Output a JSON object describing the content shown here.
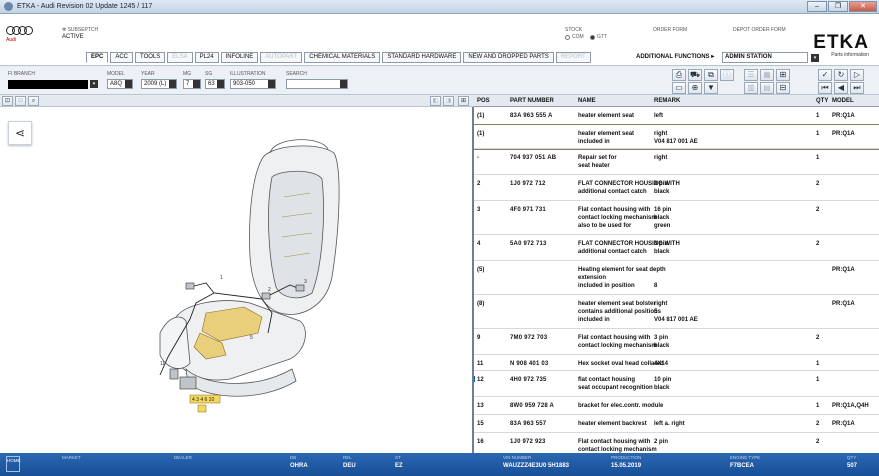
{
  "window": {
    "title": "ETKA - Audi Revision 02 Update 1245 / 117",
    "buttons": [
      "–",
      "❐",
      "✕"
    ]
  },
  "header": {
    "brand_word": "Audi",
    "sub_label": "✻ SUBSEPTCH",
    "sub_value": "ACTIVE",
    "radio_label": "STOCK",
    "radio_a": "COM",
    "radio_b": "GTT",
    "order_label": "ORDER FORM",
    "depot_label": "DEPOT ORDER FORM",
    "etka": "ETKA",
    "etka_sub": "Parts information"
  },
  "tabs": [
    {
      "label": "EPC",
      "state": "active"
    },
    {
      "label": "ACC",
      "state": "normal"
    },
    {
      "label": "TOOLS",
      "state": "normal"
    },
    {
      "label": "ELSA",
      "state": "disabled"
    },
    {
      "label": "PL24",
      "state": "normal"
    },
    {
      "label": "INFOLINE",
      "state": "normal"
    },
    {
      "label": "AUTOPART",
      "state": "disabled"
    },
    {
      "label": "CHEMICAL MATERIALS",
      "state": "normal"
    },
    {
      "label": "STANDARD HARDWARE",
      "state": "normal"
    },
    {
      "label": "NEW AND DROPPED PARTS",
      "state": "normal"
    },
    {
      "label": "REPORT",
      "state": "disabled"
    }
  ],
  "additional_functions": "ADDITIONAL FUNCTIONS ▸",
  "station": "ADMIN STATION",
  "selection": {
    "fi_label": "FI BRANCH",
    "model_label": "MODEL",
    "model": "A8Q",
    "year_label": "YEAR",
    "year": "2009 (L)",
    "mg_label": "MG",
    "mg": "7",
    "sg_label": "SG",
    "sg": "63",
    "illus_label": "ILLUSTRATION",
    "illus": "903-050",
    "search_label": "SEARCH"
  },
  "table": {
    "headers": {
      "pos": "POS",
      "part": "PART NUMBER",
      "name": "NAME",
      "remark": "REMARK",
      "qty": "QTY",
      "model": "MODEL"
    },
    "rows": [
      {
        "pos": "(1)",
        "part": "83A 963 555 A",
        "name": "heater element seat",
        "remark": "left",
        "qty": "1",
        "model": "PR:Q1A",
        "h": 18
      },
      {
        "pos": "(1)",
        "part": "",
        "name": "heater element seat\n      included in",
        "remark": "right\nV04 817 001 AE",
        "qty": "1",
        "model": "PR:Q1A",
        "h": 24,
        "sel": true
      },
      {
        "pos": "-",
        "part": "704 937 051 AB",
        "name": "Repair set for\nseat heater",
        "remark": "right",
        "qty": "1",
        "model": "",
        "h": 26
      },
      {
        "pos": "2",
        "part": "1J0 972 712",
        "name": "FLAT CONNECTOR HOUSING WITH\nadditional contact catch",
        "remark": "2 pin\nblack",
        "qty": "2",
        "model": "",
        "h": 26
      },
      {
        "pos": "3",
        "part": "4F0 971 731",
        "name": "Flat contact housing with\ncontact locking mechanism\n      also to be used for",
        "remark": "16 pin\nblack\ngreen",
        "qty": "2",
        "model": "",
        "h": 34
      },
      {
        "pos": "4",
        "part": "5A0 972 713",
        "name": "FLAT CONNECTOR HOUSING WITH\nadditional contact catch",
        "remark": "3 pin\nblack",
        "qty": "2",
        "model": "",
        "h": 26
      },
      {
        "pos": "(5)",
        "part": "",
        "name": "Heating element for seat depth\nextension\n      included in position",
        "remark": "\n\n8",
        "qty": "",
        "model": "PR:Q1A",
        "h": 34
      },
      {
        "pos": "(8)",
        "part": "",
        "name": "heater element seat bolster\ncontains additional positions\n      included in",
        "remark": "right\n5\nV04 817 001 AE",
        "qty": "",
        "model": "PR:Q1A",
        "h": 34
      },
      {
        "pos": "9",
        "part": "7M0 972 703",
        "name": "Flat contact housing with\ncontact locking mechanism",
        "remark": "3 pin\nblack",
        "qty": "2",
        "model": "",
        "h": 26
      },
      {
        "pos": "11",
        "part": "N 908 401 03",
        "name": "Hex socket oval head collared",
        "remark": "4X14",
        "qty": "1",
        "model": "",
        "h": 16
      },
      {
        "pos": "12",
        "part": "4H0 972 735",
        "name": "flat contact housing\nseat occupant recognition",
        "remark": "10 pin\nblack",
        "qty": "1",
        "model": "",
        "h": 26,
        "mark": true
      },
      {
        "pos": "13",
        "part": "8W0 959 728 A",
        "name": "bracket for elec.contr. module",
        "remark": "",
        "qty": "1",
        "model": "PR:Q1A,Q4H",
        "h": 18
      },
      {
        "pos": "15",
        "part": "83A 963 557",
        "name": "heater element backrest",
        "remark": "left a. right",
        "qty": "2",
        "model": "PR:Q1A",
        "h": 18
      },
      {
        "pos": "16",
        "part": "1J0 972 923",
        "name": "Flat contact housing with\ncontact locking mechanism",
        "remark": "2 pin",
        "qty": "2",
        "model": "",
        "h": 26
      }
    ]
  },
  "illustration": {
    "share_icon": "share-icon",
    "callout": "4 3 4 6 10"
  },
  "status": {
    "home": "HOME",
    "items": [
      {
        "label": "MARKET",
        "value": ""
      },
      {
        "label": "DEALER",
        "value": ""
      },
      {
        "label": "DB",
        "value": "OHRA"
      },
      {
        "label": "REL",
        "value": "DEU"
      },
      {
        "label": "ST",
        "value": "EZ"
      },
      {
        "label": "VIN NUMBER",
        "value": "WAUZZZ4E3U0 5H1883"
      },
      {
        "label": "PRODUCTION",
        "value": "15.05.2019"
      },
      {
        "label": "ENGINE TYPE",
        "value": "F7BCEA"
      },
      {
        "label": "QTY",
        "value": "507"
      }
    ]
  },
  "colors": {
    "statusbar": "#1f5aa3",
    "accent": "#1a59a6"
  }
}
